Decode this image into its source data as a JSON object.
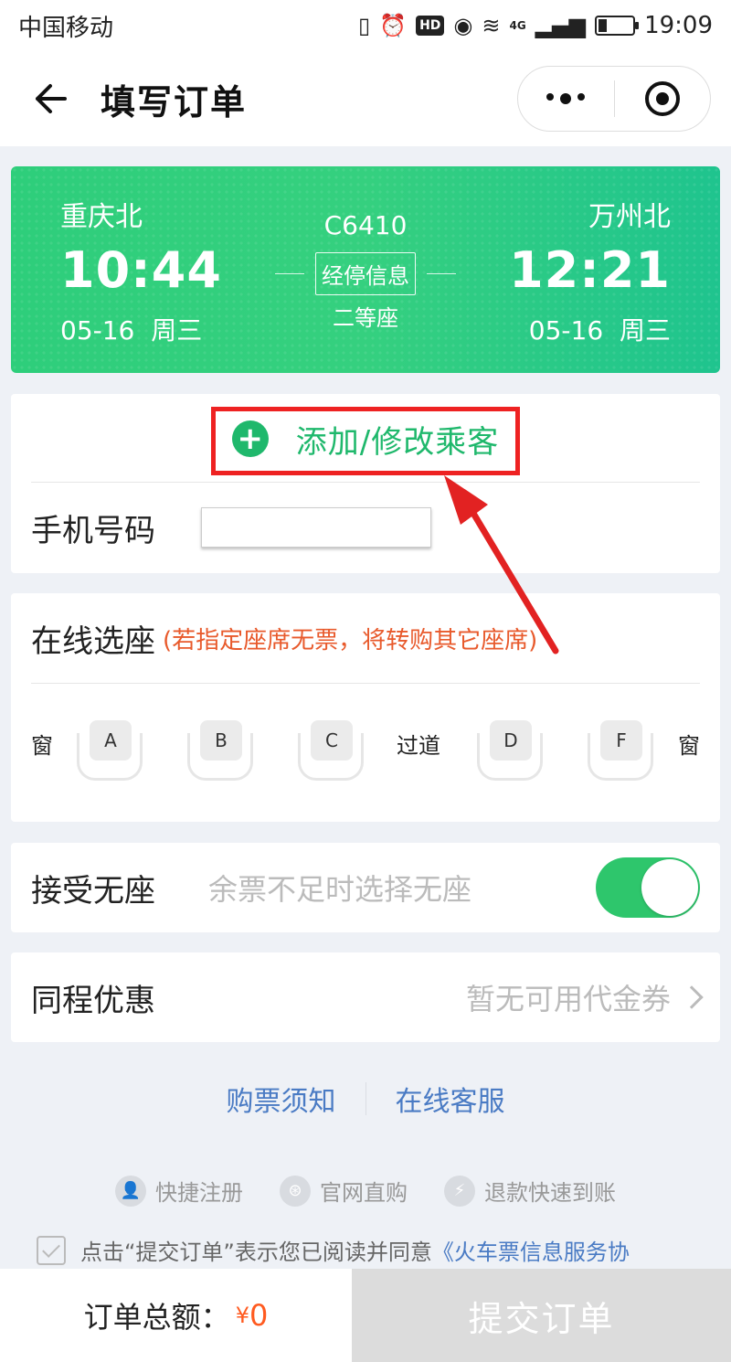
{
  "status_bar": {
    "carrier": "中国移动",
    "time": "19:09",
    "network": "4G",
    "hd": "HD"
  },
  "nav": {
    "title": "填写订单"
  },
  "train": {
    "from_station": "重庆北",
    "from_time": "10:44",
    "from_date": "05-16",
    "from_weekday": "周三",
    "to_station": "万州北",
    "to_time": "12:21",
    "to_date": "05-16",
    "to_weekday": "周三",
    "train_no": "C6410",
    "stop_info": "经停信息",
    "seat_class": "二等座"
  },
  "passenger": {
    "add_label": "添加/修改乘客",
    "phone_label": "手机号码",
    "phone_value": ""
  },
  "seat_select": {
    "title": "在线选座",
    "hint": "(若指定座席无票，将转购其它座席)",
    "window_left": "窗",
    "window_right": "窗",
    "aisle": "过道",
    "seats": [
      "A",
      "B",
      "C",
      "D",
      "F"
    ]
  },
  "no_seat": {
    "label": "接受无座",
    "hint": "余票不足时选择无座",
    "enabled": true
  },
  "promo": {
    "label": "同程优惠",
    "value": "暂无可用代金券"
  },
  "links": {
    "notice": "购票须知",
    "service": "在线客服"
  },
  "features": [
    "快捷注册",
    "官网直购",
    "退款快速到账"
  ],
  "agreement": {
    "text": "点击“提交订单”表示您已阅读并同意",
    "link": "《火车票信息服务协"
  },
  "footer": {
    "total_label": "订单总额：",
    "currency": "¥",
    "amount": "0",
    "submit": "提交订单"
  },
  "colors": {
    "accent_green": "#1fb86c",
    "highlight_red": "#e22222",
    "price_orange": "#ff5a1f",
    "link_blue": "#4a7bc4"
  }
}
